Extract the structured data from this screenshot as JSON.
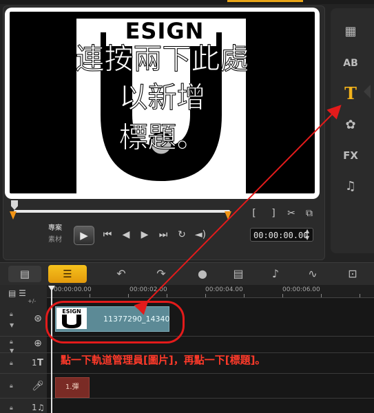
{
  "preview": {
    "title_overlay": [
      "連按兩下此處",
      "以新增",
      "標題。"
    ],
    "thumbnail_logo_text": "ESIGN",
    "mode_project": "專案",
    "mode_clip": "素材",
    "timecode": "00:00:00.00",
    "mark_in": "[",
    "mark_out": "]"
  },
  "tools": [
    {
      "name": "media-icon"
    },
    {
      "name": "transition-icon",
      "label": "AB"
    },
    {
      "name": "title-icon",
      "label": "T"
    },
    {
      "name": "graphic-icon"
    },
    {
      "name": "filter-icon",
      "label": "FX"
    },
    {
      "name": "audio-icon"
    }
  ],
  "timeline": {
    "ruler_labels": [
      "00:00:00.00",
      "00:00:02.00",
      "00:00:04.00",
      "00:00:06.00"
    ],
    "track_numbers": [
      "1",
      "1"
    ],
    "image_clip_label": "11377290_14340",
    "audio_clip_label": "1.彈",
    "zoom_controls": "+/-"
  },
  "annotation": {
    "instruction": "點一下軌道管理員[圖片]，再點一下[標題]。",
    "color": "#e31b1b"
  },
  "colors": {
    "accent": "#f2b21b",
    "clip": "#5c8a96",
    "audio_clip": "#7a2b25"
  }
}
